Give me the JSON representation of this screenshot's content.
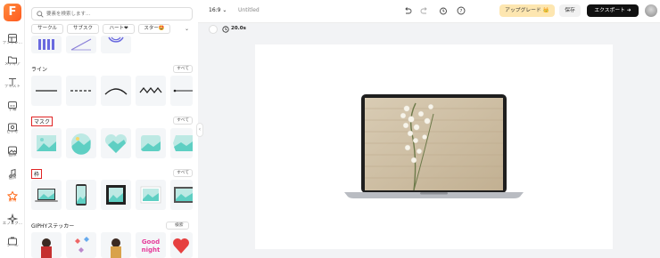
{
  "rail": {
    "logo": "F",
    "items": [
      {
        "label": "テンプレ…",
        "icon": "template-icon"
      },
      {
        "label": "メディア",
        "icon": "media-icon"
      },
      {
        "label": "テキスト",
        "icon": "text-icon"
      },
      {
        "label": "字幕",
        "icon": "subtitle-icon"
      },
      {
        "label": "ビデオ",
        "icon": "video-icon"
      },
      {
        "label": "画像",
        "icon": "image-icon"
      },
      {
        "label": "音声",
        "icon": "audio-icon"
      },
      {
        "label": "素材",
        "icon": "elements-icon",
        "active": true
      },
      {
        "label": "エフェク…",
        "icon": "effects-icon"
      },
      {
        "label": "ツール",
        "icon": "tools-icon"
      }
    ]
  },
  "panel": {
    "search_placeholder": "要素を検索します...",
    "categories": [
      "サークル",
      "サブスク",
      "ハート❤",
      "スター🤩"
    ],
    "sections": {
      "line": {
        "title": "ライン",
        "see_all": "すべて"
      },
      "mask": {
        "title": "マスク",
        "see_all": "すべて"
      },
      "frame": {
        "title": "枠",
        "see_all": "すべて"
      },
      "giphy": {
        "title": "GIPHYステッカー",
        "search_label": "検索"
      }
    },
    "sticker_text": "Good\nnight"
  },
  "topbar": {
    "ratio": "16:9",
    "doc_title": "Untitled",
    "upgrade": "アップグレード",
    "save": "保存",
    "export": "エクスポート"
  },
  "subbar": {
    "duration": "20.0s"
  },
  "colors": {
    "accent": "#ff6a1a",
    "mask_teal": "#6fd6cc",
    "highlight": "#e02424"
  }
}
